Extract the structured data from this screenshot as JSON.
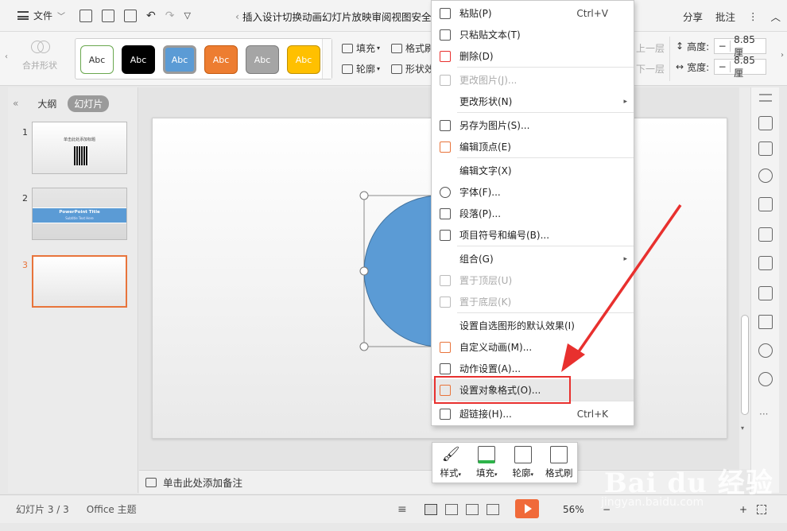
{
  "titlebar": {
    "file_menu": "文件",
    "tabs_text": "插入设计切换动画幻灯片放映审阅视图安全 开",
    "share": "分享",
    "comment": "批注",
    "more": "⋮",
    "collapse": "︿"
  },
  "ribbon": {
    "merge_shape": "合并形状",
    "style_swatches": [
      {
        "label": "Abc",
        "bg": "#ffffff",
        "fg": "#333333",
        "border": "#6aa84f"
      },
      {
        "label": "Abc",
        "bg": "#000000",
        "fg": "#ffffff",
        "border": "#000000"
      },
      {
        "label": "Abc",
        "bg": "#5b9bd5",
        "fg": "#ffffff",
        "border": "#41719c"
      },
      {
        "label": "Abc",
        "bg": "#ed7d31",
        "fg": "#ffffff",
        "border": "#c55a11"
      },
      {
        "label": "Abc",
        "bg": "#a5a5a5",
        "fg": "#ffffff",
        "border": "#7c7c7c"
      },
      {
        "label": "Abc",
        "bg": "#ffc000",
        "fg": "#ffffff",
        "border": "#bf9000"
      }
    ],
    "fill": "填充",
    "outline": "轮廓",
    "format_painter": "格式刷",
    "shape_effect": "形状效",
    "up_layer": "上一层",
    "down_layer": "下一层",
    "height_label": "高度:",
    "height_value": "8.85厘",
    "width_label": "宽度:",
    "width_value": "8.85厘"
  },
  "left_panel": {
    "tab_outline": "大纲",
    "tab_slides": "幻灯片",
    "slides": [
      {
        "num": "1",
        "title": "单击此处添加标题"
      },
      {
        "num": "2",
        "title": "PowerPoint Title",
        "subtitle": "Subtitle Text Here"
      },
      {
        "num": "3"
      }
    ]
  },
  "notes": {
    "placeholder": "单击此处添加备注"
  },
  "status": {
    "slide_info": "幻灯片 3 / 3",
    "theme": "Office 主题",
    "zoom": "56%",
    "zoom_minus": "−",
    "zoom_plus": "+"
  },
  "context_menu": {
    "items": [
      {
        "label": "粘贴(P)",
        "shortcut": "Ctrl+V",
        "icon": "paste-icon"
      },
      {
        "label": "只粘贴文本(T)",
        "icon": "paste-text-icon"
      },
      {
        "label": "删除(D)",
        "icon": "delete-icon"
      },
      {
        "label": "更改图片(J)...",
        "icon": "change-picture-icon",
        "disabled": true
      },
      {
        "label": "更改形状(N)",
        "submenu": true
      },
      {
        "label": "另存为图片(S)...",
        "icon": "save-picture-icon"
      },
      {
        "label": "编辑顶点(E)",
        "icon": "edit-points-icon"
      },
      {
        "label": "编辑文字(X)"
      },
      {
        "label": "字体(F)...",
        "icon": "font-icon"
      },
      {
        "label": "段落(P)...",
        "icon": "paragraph-icon"
      },
      {
        "label": "项目符号和编号(B)...",
        "icon": "bullets-icon"
      },
      {
        "label": "组合(G)",
        "submenu": true
      },
      {
        "label": "置于顶层(U)",
        "icon": "bring-front-icon",
        "disabled": true
      },
      {
        "label": "置于底层(K)",
        "icon": "send-back-icon",
        "disabled": true
      },
      {
        "label": "设置自选图形的默认效果(I)"
      },
      {
        "label": "自定义动画(M)...",
        "icon": "animation-icon"
      },
      {
        "label": "动作设置(A)...",
        "icon": "action-icon"
      },
      {
        "label": "设置对象格式(O)...",
        "icon": "format-object-icon"
      },
      {
        "label": "超链接(H)...",
        "shortcut": "Ctrl+K",
        "icon": "hyperlink-icon"
      }
    ]
  },
  "float_toolbar": {
    "style": "样式",
    "fill": "填充",
    "outline": "轮廓",
    "painter": "格式刷"
  },
  "watermark": {
    "brand": "Bai du 经验",
    "url": "jingyan.baidu.com"
  },
  "colors": {
    "accent_orange": "#e8743b",
    "shape_blue": "#5b9bd5",
    "annotation_red": "#e8302e"
  }
}
